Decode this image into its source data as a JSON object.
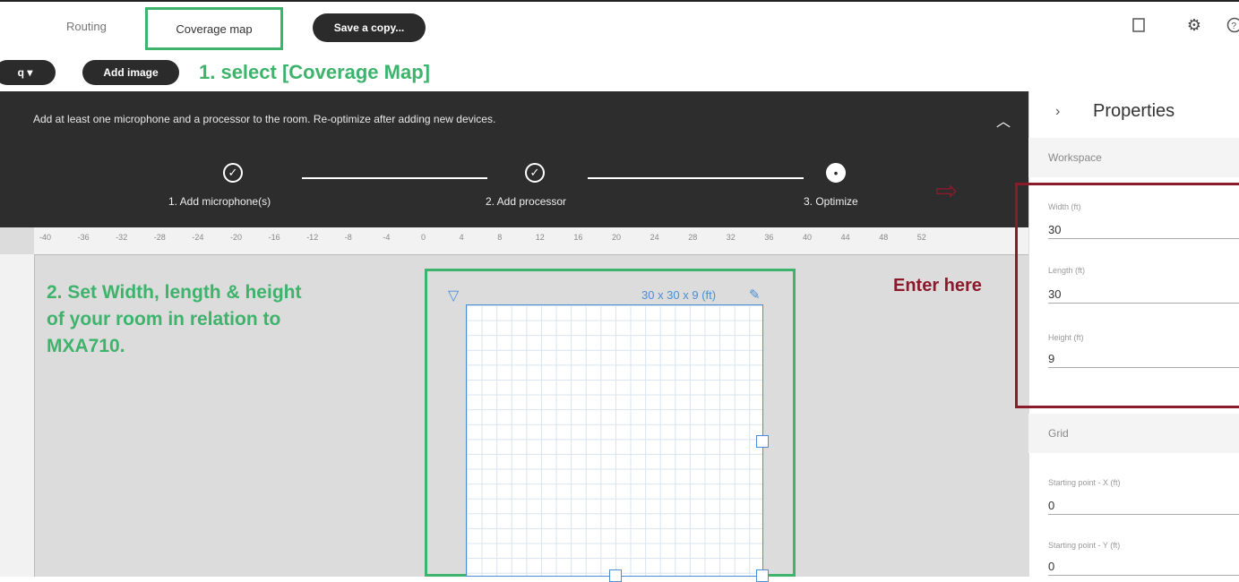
{
  "tabs": {
    "routing": "Routing",
    "coverage_map": "Coverage map"
  },
  "toolbar": {
    "save_copy": "Save a copy...",
    "dropdown_label": "q ▾",
    "add_image": "Add image"
  },
  "annotations": {
    "step1": "1. select [Coverage Map]",
    "step2": "2. Set Width, length & height of your room in relation to MXA710.",
    "enter_here": "Enter here",
    "color_green": "#3db36b",
    "color_red": "#8b1a2b"
  },
  "banner": {
    "message": "Add at least one microphone and a processor to the room. Re-optimize after adding new devices.",
    "steps": [
      {
        "label": "1. Add microphone(s)",
        "state": "done"
      },
      {
        "label": "2. Add processor",
        "state": "done"
      },
      {
        "label": "3. Optimize",
        "state": "current"
      }
    ]
  },
  "ruler": {
    "top_ticks": [
      "-40",
      "-36",
      "-32",
      "-28",
      "-24",
      "-20",
      "-16",
      "-12",
      "-8",
      "-4",
      "0",
      "4",
      "8",
      "12",
      "16",
      "20",
      "24",
      "28",
      "32",
      "36",
      "40",
      "44",
      "48",
      "52"
    ]
  },
  "room": {
    "dimensions_label": "30 x 30 x 9 (ft)"
  },
  "properties": {
    "title": "Properties",
    "workspace": {
      "heading": "Workspace",
      "width_label": "Width (ft)",
      "width_value": "30",
      "length_label": "Length (ft)",
      "length_value": "30",
      "height_label": "Height (ft)",
      "height_value": "9"
    },
    "grid": {
      "heading": "Grid",
      "start_x_label": "Starting point - X (ft)",
      "start_x_value": "0",
      "start_y_label": "Starting point - Y (ft)",
      "start_y_value": "0"
    }
  }
}
